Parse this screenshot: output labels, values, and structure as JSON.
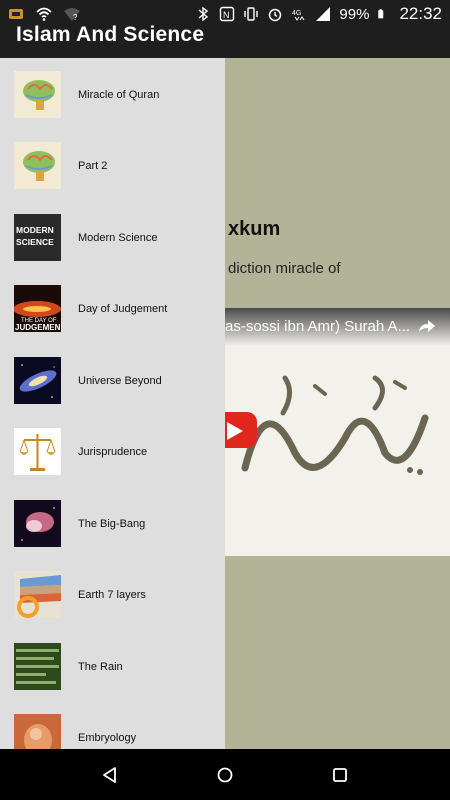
{
  "status_bar": {
    "battery": "99%",
    "time": "22:32",
    "icons": [
      "notification-app-icon",
      "wifi-icon",
      "wifi-question-icon",
      "bluetooth-icon",
      "nfc-icon",
      "vibrate-icon",
      "alarm-icon",
      "data-lte-icon",
      "signal-icon",
      "battery-icon"
    ]
  },
  "app_bar": {
    "title": "Islam And Science"
  },
  "content": {
    "title": "xkum",
    "subtitle": "diction miracle of",
    "video_title": "as-sossi ibn Amr) Surah A..."
  },
  "drawer": {
    "items": [
      {
        "label": "Miracle of Quran",
        "icon": "brain-thumbnail"
      },
      {
        "label": "Part 2",
        "icon": "brain-thumbnail"
      },
      {
        "label": "Modern Science",
        "icon": "modern-science-thumbnail"
      },
      {
        "label": "Day of Judgement",
        "icon": "day-of-judgement-thumbnail"
      },
      {
        "label": "Universe Beyond",
        "icon": "galaxy-thumbnail"
      },
      {
        "label": "Jurisprudence",
        "icon": "scales-thumbnail"
      },
      {
        "label": "The Big-Bang",
        "icon": "nebula-thumbnail"
      },
      {
        "label": "Earth 7 layers",
        "icon": "earth-layers-thumbnail"
      },
      {
        "label": "The Rain",
        "icon": "rain-thumbnail"
      },
      {
        "label": "Embryology",
        "icon": "embryo-thumbnail"
      }
    ],
    "thumb_texts": {
      "modern_science": [
        "MODERN",
        "SCIENCE"
      ],
      "day_of_judgement": [
        "THE DAY OF",
        "JUDGEMEN"
      ]
    }
  },
  "colors": {
    "status_bar": "#1e1e1e",
    "content_bg": "#b3b497",
    "drawer_bg": "#dedede",
    "play_button": "#e0261d"
  }
}
